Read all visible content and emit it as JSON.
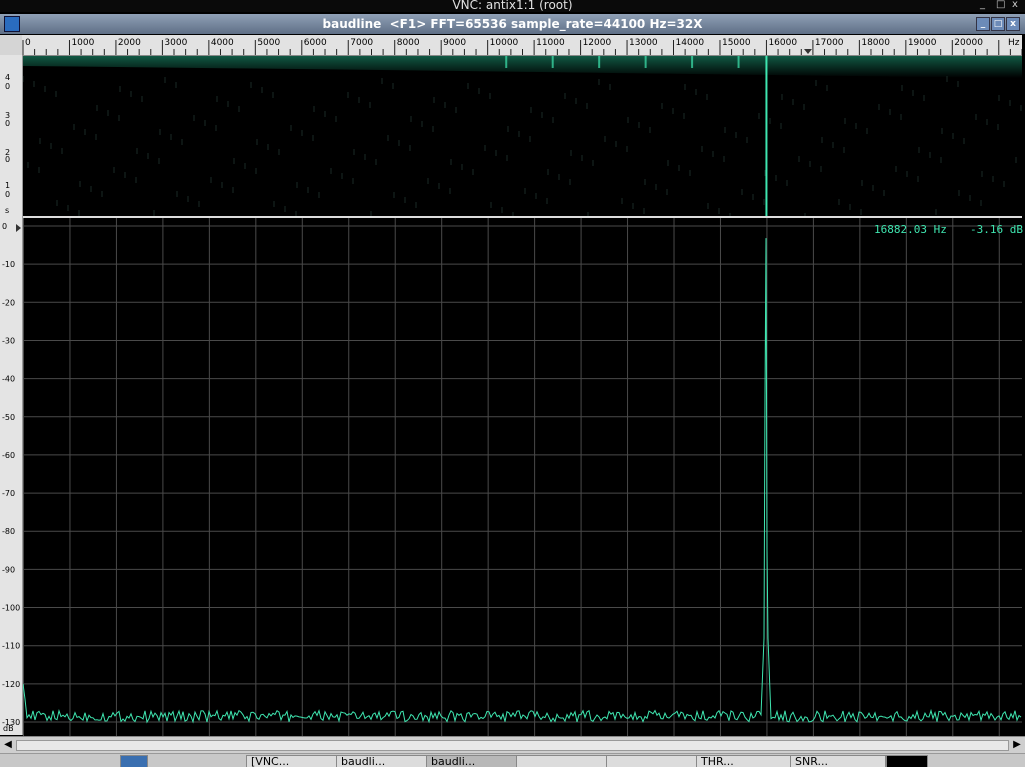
{
  "vnc": {
    "title": "VNC: antix1:1 (root)"
  },
  "window": {
    "title": "baudline  <F1> FFT=65536 sample_rate=44100 Hz=32X",
    "buttons": [
      "_",
      "□",
      "x"
    ]
  },
  "freq_axis": {
    "ticks": [
      0,
      1000,
      2000,
      3000,
      4000,
      5000,
      6000,
      7000,
      8000,
      9000,
      10000,
      11000,
      12000,
      13000,
      14000,
      15000,
      16000,
      17000,
      18000,
      19000,
      20000
    ],
    "unit": "Hz",
    "max_hz": 21500
  },
  "waterfall_axis": {
    "labels": [
      "4",
      "0",
      "3",
      "0",
      "2",
      "0",
      "1",
      "0",
      "s"
    ]
  },
  "db_axis": {
    "ticks": [
      "0",
      "-10",
      "-20",
      "-30",
      "-40",
      "-50",
      "-60",
      "-70",
      "-80",
      "-90",
      "-100",
      "-110",
      "-120",
      "-130"
    ],
    "unit": "dB",
    "min": -130,
    "max": 0
  },
  "cursor_readout": {
    "freq": "16882.03 Hz",
    "level": "-3.16 dB"
  },
  "colors": {
    "trace": "#3fe6b0",
    "grid": "#4a4a4a",
    "background": "#000000",
    "waterfall": "#1ea07a"
  },
  "chart_data": {
    "type": "line",
    "x_unit": "Hz",
    "y_unit": "dB",
    "xlim": [
      0,
      21500
    ],
    "ylim": [
      -130,
      0
    ],
    "grid": true,
    "noise_floor_db": -128.5,
    "peaks": [
      {
        "x": 16000,
        "y": -3.16
      },
      {
        "x": 15950,
        "y": -45
      },
      {
        "x": 16050,
        "y": -108
      }
    ]
  },
  "taskbar": {
    "items": [
      "[VNC...",
      "baudli...",
      "baudli...",
      "",
      "",
      "",
      "THR...",
      "SNR..."
    ]
  }
}
